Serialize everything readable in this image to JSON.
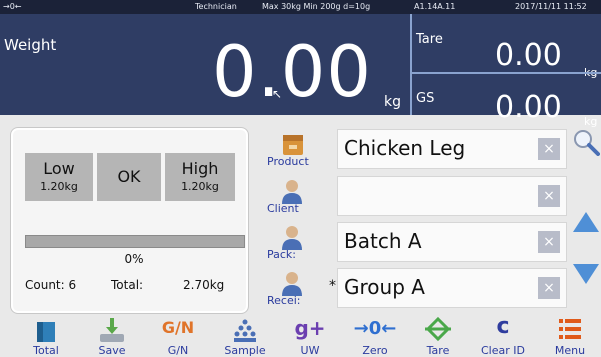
{
  "status": {
    "left_icons": "→0←",
    "user": "Technician",
    "limits": "Max 30kg  Min 200g  d=10g",
    "version": "A1.14A.11",
    "datetime": "2017/11/11  11:52"
  },
  "weight": {
    "label": "Weight",
    "value": "0.00",
    "unit": "kg",
    "tare_label": "Tare",
    "tare_value": "0.00",
    "tare_unit": "kg",
    "gs_label": "GS",
    "gs_value": "0.00",
    "gs_unit": "kg"
  },
  "check": {
    "low_label": "Low",
    "low_value": "1.20kg",
    "ok_label": "OK",
    "high_label": "High",
    "high_value": "1.20kg",
    "progress_percent": 0,
    "progress_text": "0%",
    "count_text": "Count: 6",
    "total_label": "Total:",
    "total_value": "2.70kg"
  },
  "fields": {
    "product": {
      "label": "Product",
      "value": "Chicken Leg",
      "clear": "×"
    },
    "client": {
      "label": "Client",
      "value": "",
      "clear": "×"
    },
    "pack": {
      "label": "Pack:",
      "value": "Batch A",
      "clear": "×"
    },
    "receiver": {
      "label": "Recei:",
      "value": "Group A",
      "clear": "×",
      "required_mark": "*"
    }
  },
  "toolbar": {
    "total": "Total",
    "save": "Save",
    "gn": "G/N",
    "gn_icon_text": "G/N",
    "sample": "Sample",
    "uw": "UW",
    "zero": "Zero",
    "tare": "Tare",
    "clear_id": "Clear ID",
    "menu": "Menu"
  },
  "colors": {
    "panel_blue": "#2f3d64",
    "label_blue": "#2a3b9e",
    "status_bar": "#1b2238"
  }
}
